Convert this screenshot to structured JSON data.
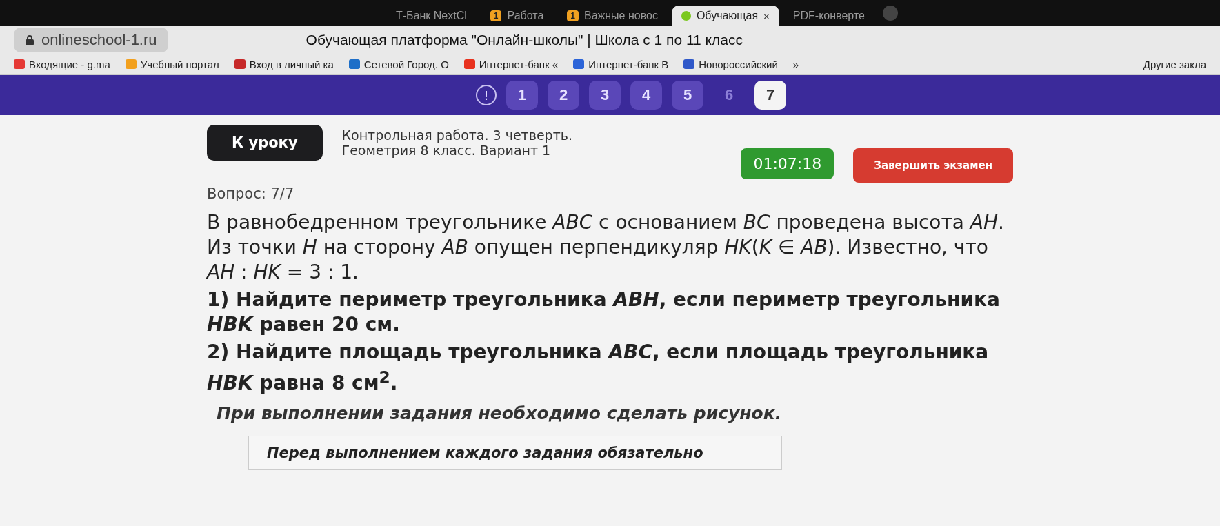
{
  "browser": {
    "tabs": [
      {
        "label": "Т-Банк NextCl",
        "selected": false
      },
      {
        "label": "Работа",
        "selected": false,
        "badge": "1"
      },
      {
        "label": "Важные новос",
        "selected": false,
        "badge": "1"
      },
      {
        "label": "Обучающая",
        "selected": true,
        "close": "×"
      },
      {
        "label": "PDF-конверте",
        "selected": false
      }
    ],
    "address": "onlineschool-1.ru",
    "page_title": "Обучающая платформа \"Онлайн-школы\" | Школа с 1 по 11 класс",
    "bookmarks": [
      {
        "label": "Входящие - g.ma",
        "color": "#e53935"
      },
      {
        "label": "Учебный портал",
        "color": "#f2a01e"
      },
      {
        "label": "Вход в личный ка",
        "color": "#c62828"
      },
      {
        "label": "Сетевой Город. О",
        "color": "#1e6fc8"
      },
      {
        "label": "Интернет-банк «",
        "color": "#e8321e"
      },
      {
        "label": "Интернет-банк В",
        "color": "#2c64d8"
      },
      {
        "label": "Новороссийский",
        "color": "#2f58c9"
      }
    ],
    "more": "»",
    "other_bookmarks": "Другие закла"
  },
  "question_nav": {
    "alert": "!",
    "items": [
      {
        "label": "1",
        "answered": true,
        "selected": false
      },
      {
        "label": "2",
        "answered": true,
        "selected": false
      },
      {
        "label": "3",
        "answered": true,
        "selected": false
      },
      {
        "label": "4",
        "answered": true,
        "selected": false
      },
      {
        "label": "5",
        "answered": true,
        "selected": false
      },
      {
        "label": "6",
        "answered": false,
        "selected": false
      },
      {
        "label": "7",
        "answered": false,
        "selected": true
      }
    ]
  },
  "header": {
    "back_button": "К уроку",
    "title_lines": [
      "Контрольная работа. 3 четверть.",
      "Геометрия 8 класс. Вариант 1"
    ],
    "timer": "01:07:18",
    "finish_button": "Завершить экзамен"
  },
  "question": {
    "counter": "Вопрос: 7/7",
    "paragraphs": [
      {
        "kind": "plain",
        "text": "В равнобедренном треугольнике *ABC* с основанием *BC* проведена высота *AH*. Из точки *H* на сторону *AB* опущен перпендикуляр *HK*(*K* ∈ *AB*). Известно, что *AH* : *HK* = 3 : 1."
      },
      {
        "kind": "task",
        "text": "1) Найдите периметр треугольника *ABH*, если периметр треугольника *HBK* равен 20 см."
      },
      {
        "kind": "task",
        "text": "2) Найдите площадь треугольника *ABC*, если площадь треугольника *HBK* равна 8 см$^{2}$."
      },
      {
        "kind": "note",
        "text": "При выполнении задания необходимо сделать рисунок."
      }
    ],
    "notice": "Перед выполнением каждого задания обязательно"
  }
}
